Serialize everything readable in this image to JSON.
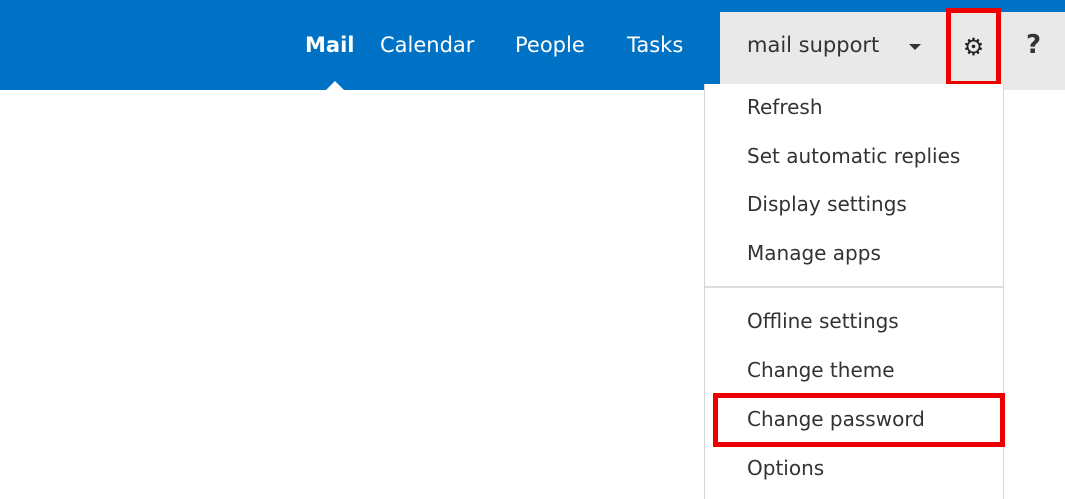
{
  "nav": {
    "items": [
      {
        "label": "Mail"
      },
      {
        "label": "Calendar"
      },
      {
        "label": "People"
      },
      {
        "label": "Tasks"
      }
    ]
  },
  "user": {
    "name": "mail support"
  },
  "toolbar": {
    "gear_icon": "⚙",
    "help_icon": "?"
  },
  "menu": {
    "items": [
      {
        "label": "Refresh"
      },
      {
        "label": "Set automatic replies"
      },
      {
        "label": "Display settings"
      },
      {
        "label": "Manage apps"
      },
      {
        "label": "Offline settings"
      },
      {
        "label": "Change theme"
      },
      {
        "label": "Change password"
      },
      {
        "label": "Options"
      }
    ]
  },
  "colors": {
    "nav_bar": "#0072c6",
    "highlight": "#ee0000",
    "user_area": "#e9e9e9"
  }
}
